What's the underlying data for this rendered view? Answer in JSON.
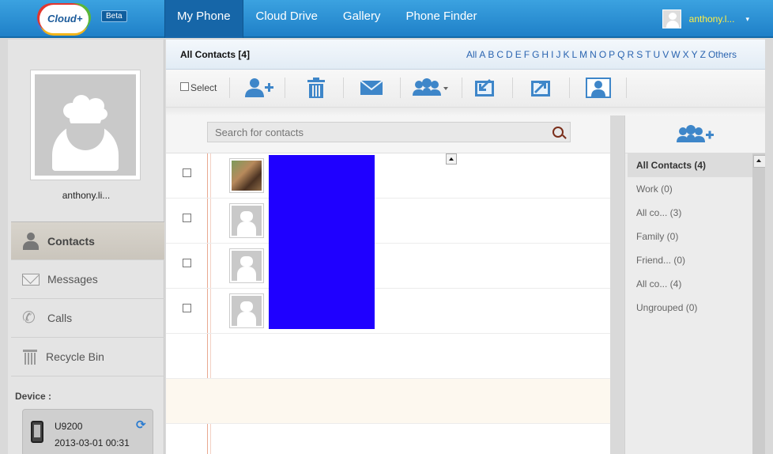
{
  "brand": {
    "logo_text": "Cloud+",
    "beta_label": "Beta"
  },
  "nav": {
    "items": [
      {
        "label": "My Phone",
        "active": true
      },
      {
        "label": "Cloud Drive",
        "active": false
      },
      {
        "label": "Gallery",
        "active": false
      },
      {
        "label": "Phone Finder",
        "active": false
      }
    ]
  },
  "user": {
    "name": "anthony.l...",
    "caret": "▾"
  },
  "sidebar": {
    "profile_name": "anthony.li...",
    "items": [
      {
        "label": "Contacts",
        "icon": "contacts-icon",
        "active": true
      },
      {
        "label": "Messages",
        "icon": "messages-icon",
        "active": false
      },
      {
        "label": "Calls",
        "icon": "calls-icon",
        "active": false
      },
      {
        "label": "Recycle Bin",
        "icon": "recycle-bin-icon",
        "active": false
      }
    ],
    "device_label": "Device :",
    "device_model": "U9200",
    "device_time": "2013-03-01 00:31"
  },
  "main": {
    "title": "All Contacts [4]",
    "alphabet": [
      "All",
      "A",
      "B",
      "C",
      "D",
      "E",
      "F",
      "G",
      "H",
      "I",
      "J",
      "K",
      "L",
      "M",
      "N",
      "O",
      "P",
      "Q",
      "R",
      "S",
      "T",
      "U",
      "V",
      "W",
      "X",
      "Y",
      "Z",
      "Others"
    ],
    "select_label": "Select",
    "search_placeholder": "Search for contacts"
  },
  "groups": {
    "items": [
      {
        "label": "All Contacts (4)",
        "active": true
      },
      {
        "label": "Work  (0)",
        "active": false
      },
      {
        "label": "All co...  (3)",
        "active": false
      },
      {
        "label": "Family  (0)",
        "active": false
      },
      {
        "label": "Friend...  (0)",
        "active": false
      },
      {
        "label": "All co...  (4)",
        "active": false
      },
      {
        "label": "Ungrouped  (0)",
        "active": false
      }
    ]
  },
  "colors": {
    "nav_blue": "#1f80c8",
    "user_name": "#ffee44",
    "link_blue": "#2a64b0",
    "redacted": "#1f00ff"
  }
}
